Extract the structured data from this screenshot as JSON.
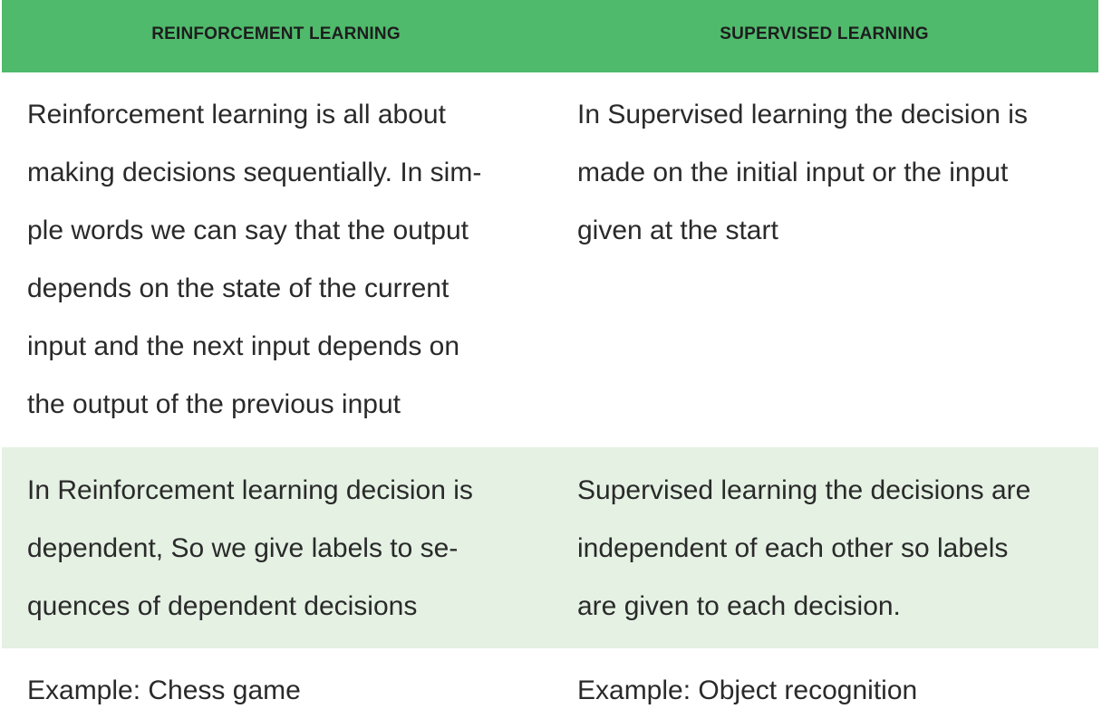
{
  "table": {
    "headers": [
      "REINFORCEMENT LEARNING",
      "SUPERVISED LEARNING"
    ],
    "rows": [
      {
        "left": [
          "Reinforcement learning is all about",
          "making decisions sequentially. In sim-",
          "ple words we can say that the output",
          "depends on the state of the current",
          "input and the next input depends on",
          "the output of the previous input"
        ],
        "right": [
          "In Supervised learning the decision is",
          "made on the initial input or the input",
          "given at the start"
        ]
      },
      {
        "left": [
          "In Reinforcement learning decision is",
          "dependent, So we give labels to se-",
          "quences of dependent decisions"
        ],
        "right": [
          "Supervised learning the decisions are",
          "independent of each other so labels",
          "are given to each decision."
        ]
      },
      {
        "left": [
          "Example: Chess game"
        ],
        "right": [
          "Example: Object recognition"
        ]
      }
    ]
  },
  "colors": {
    "header_bg": "#4fba6c",
    "alt_row_bg": "#e4f1e3",
    "text": "#2a2a2a"
  }
}
